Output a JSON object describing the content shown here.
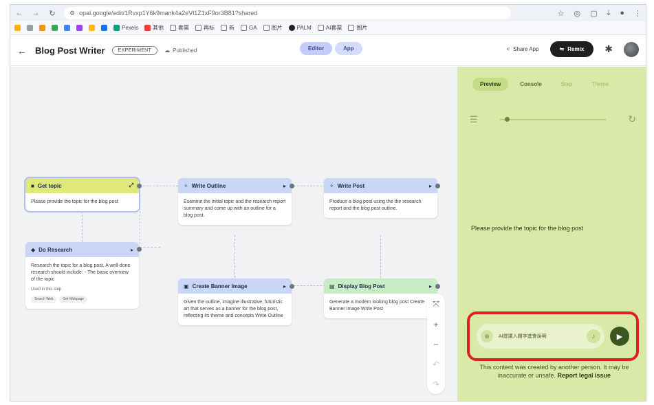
{
  "browser": {
    "url": "opal.google/edit/1Rvxp1Y6k9mank4a2eVl1Z1xF9or3B81?shared",
    "bookmarks": [
      "Pexels",
      "其他",
      "套票",
      "再标",
      "新",
      "GA",
      "图片",
      "PALM",
      "AI套票",
      "图片"
    ]
  },
  "header": {
    "title": "Blog Post Writer",
    "badge": "EXPERIMENT",
    "published": "Published",
    "tabs": [
      "Editor",
      "App"
    ],
    "share_label": "Share App",
    "remix_label": "Remix"
  },
  "nodes": {
    "get_topic": {
      "title": "Get topic",
      "body": "Please provide the topic for the blog post"
    },
    "do_research": {
      "title": "Do Research",
      "body": "Research the topic for a blog post. A well-done research should include: - The basic overview of the topic",
      "step_label": "Used in this step",
      "chips": [
        "Search Web",
        "Get Webpage"
      ]
    },
    "write_outline": {
      "title": "Write Outline",
      "body": "Examine the initial topic and the research report summary and come up with an outline for a blog post."
    },
    "write_post": {
      "title": "Write Post",
      "body": "Produce a blog post using the the research report and the blog post outline."
    },
    "create_banner": {
      "title": "Create Banner Image",
      "body": "Given the outline, imagine illustrative, futuristic art that serves as a banner for the blog post, reflecting its theme and concepts Write Outline"
    },
    "display_post": {
      "title": "Display Blog Post",
      "body": "Generate a modern looking blog post Create Banner Image Write Post"
    }
  },
  "panel": {
    "tabs": [
      "Preview",
      "Console",
      "Step",
      "Theme"
    ],
    "progress": 0.05,
    "prompt": "Please provide the topic for the blog post",
    "input_placeholder": "AI提議入題字進會說明",
    "disclaimer_text": "This content was created by another person. It may be inaccurate or unsafe.",
    "report_link": "Report legal issue"
  },
  "colors": {
    "panel_bg": "#d9e9a8",
    "highlight_border": "#e01f1f",
    "send_button": "#3b5720",
    "yellow_header": "#dfe87a",
    "blue_header": "#c9d6f5",
    "green_header": "#c8ecc6"
  }
}
